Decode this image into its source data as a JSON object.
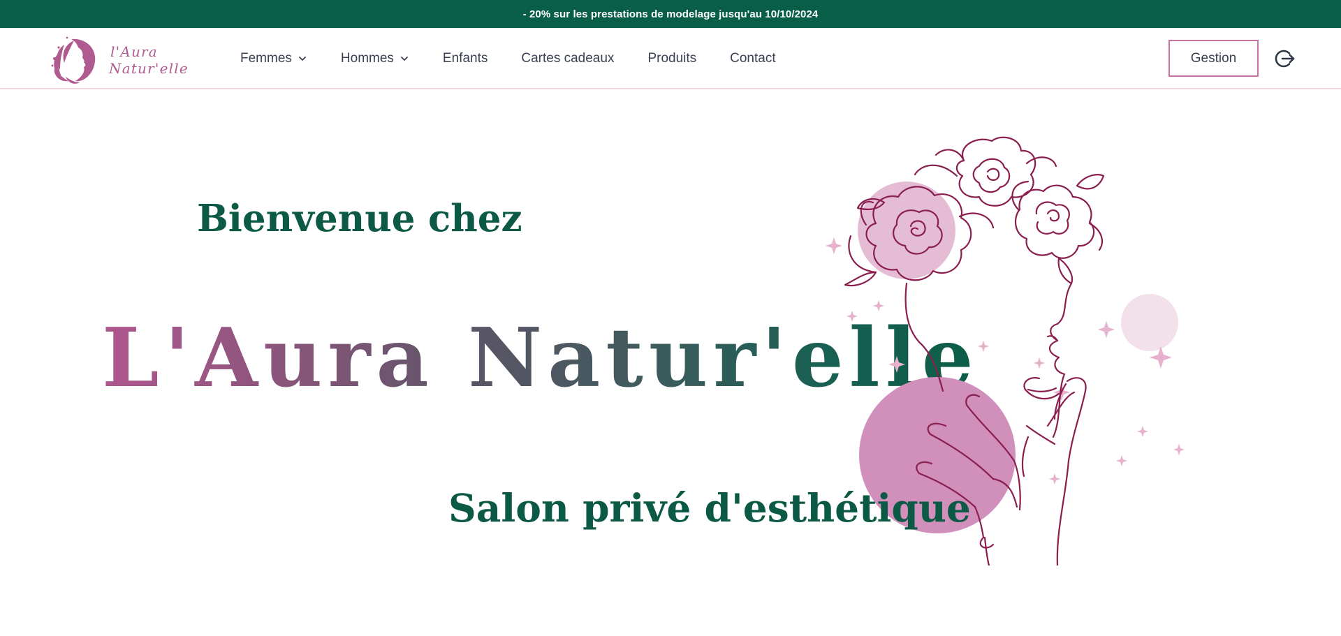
{
  "promo": {
    "text": "- 20% sur les prestations de modelage jusqu'au 10/10/2024"
  },
  "brand": {
    "logo_line1": "l'Aura",
    "logo_line2": "Natur'elle"
  },
  "nav": {
    "items": [
      {
        "label": "Femmes",
        "has_dropdown": true
      },
      {
        "label": "Hommes",
        "has_dropdown": true
      },
      {
        "label": "Enfants",
        "has_dropdown": false
      },
      {
        "label": "Cartes cadeaux",
        "has_dropdown": false
      },
      {
        "label": "Produits",
        "has_dropdown": false
      },
      {
        "label": "Contact",
        "has_dropdown": false
      }
    ],
    "gestion_label": "Gestion",
    "logout_icon": "logout-icon"
  },
  "hero": {
    "welcome": "Bienvenue chez",
    "brand_name": "L'Aura Natur'elle",
    "tagline": "Salon privé d'esthétique"
  },
  "colors": {
    "primary_green": "#085e47",
    "accent_pink": "#c873a4",
    "text_gray": "#3a4252",
    "illustration_line": "#8a1e4f"
  }
}
